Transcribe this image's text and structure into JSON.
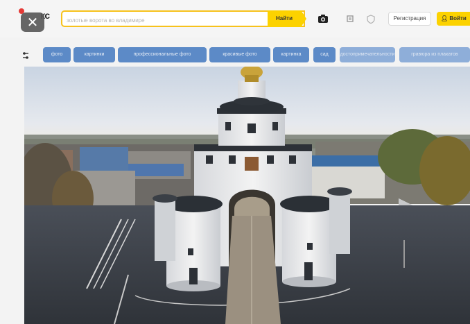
{
  "header": {
    "logo_text": "кс",
    "search_placeholder": "золотые ворота во владимире",
    "search_button": "Найти",
    "register_button": "Регистрация",
    "login_button": "Войти",
    "accent_color": "#fcd200"
  },
  "tags": [
    {
      "label": "фото"
    },
    {
      "label": "картинки"
    },
    {
      "label": "профессиональные фото"
    },
    {
      "label": "красивые фото"
    },
    {
      "label": "картинка"
    },
    {
      "label": "сад"
    },
    {
      "label": "достопримечательности"
    },
    {
      "label": "гравюра из плакатов"
    }
  ],
  "icons": {
    "close": "close-icon",
    "camera": "camera-icon",
    "collections": "collections-icon",
    "shield": "shield-icon",
    "user": "user-icon",
    "filter": "filter-icon"
  }
}
